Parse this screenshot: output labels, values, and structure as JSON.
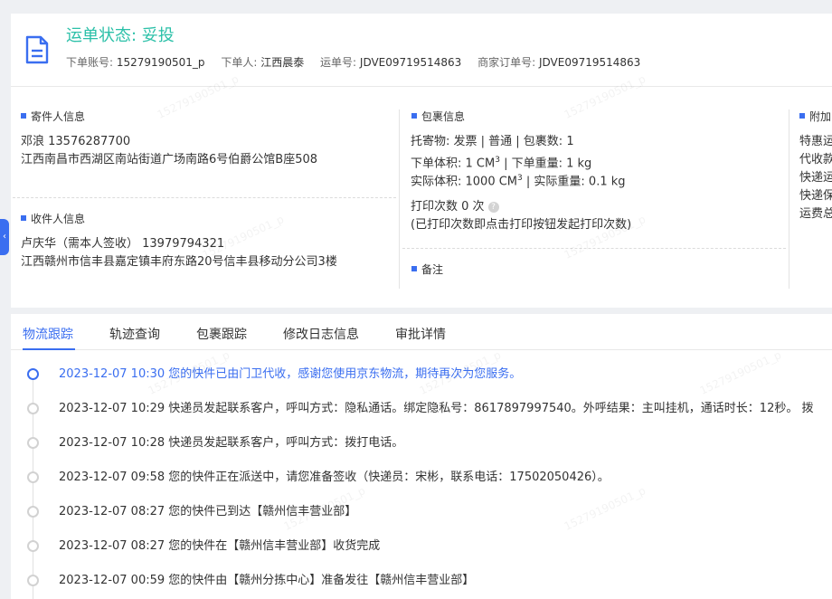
{
  "header": {
    "status_label": "运单状态: 妥投",
    "meta": [
      {
        "key": "下单账号:",
        "value": "15279190501_p"
      },
      {
        "key": "下单人:",
        "value": "江西晨泰"
      },
      {
        "key": "运单号:",
        "value": "JDVE09719514863"
      },
      {
        "key": "商家订单号:",
        "value": "JDVE09719514863"
      }
    ]
  },
  "sender": {
    "title": "寄件人信息",
    "name_phone": "邓浪    13576287700",
    "address": "江西南昌市西湖区南站街道广场南路6号伯爵公馆B座508"
  },
  "receiver": {
    "title": "收件人信息",
    "name_phone": "卢庆华（需本人签收）   13979794321",
    "address": "江西赣州市信丰县嘉定镇丰府东路20号信丰县移动分公司3楼"
  },
  "package": {
    "title": "包裹信息",
    "goods": "托寄物:  发票 | 普通  |  包裹数:  1",
    "order_volume_prefix": "下单体积:    1 CM",
    "order_volume_sup": "3",
    "order_weight": "  |  下单重量:    1 kg",
    "actual_volume_prefix": "实际体积:    1000 CM",
    "actual_volume_sup": "3",
    "actual_weight": "  |  实际重量:    0.1 kg",
    "print_count": "打印次数    0 次",
    "print_hint": "(已打印次数即点击打印按钮发起打印次数)"
  },
  "remark": {
    "title": "备注"
  },
  "extra": {
    "title": "附加",
    "lines": [
      "特惠运",
      "代收款",
      "快递运",
      "快递保",
      "运费总"
    ]
  },
  "side_tab": {
    "icon": "‹"
  },
  "tabs": [
    {
      "label": "物流跟踪"
    },
    {
      "label": "轨迹查询"
    },
    {
      "label": "包裹跟踪"
    },
    {
      "label": "修改日志信息"
    },
    {
      "label": "审批详情"
    }
  ],
  "timeline": [
    {
      "text": "2023-12-07 10:30 您的快件已由门卫代收，感谢您使用京东物流，期待再次为您服务。"
    },
    {
      "text": "2023-12-07 10:29 快递员发起联系客户，呼叫方式：隐私通话。绑定隐私号：8617897997540。外呼结果：主叫挂机，通话时长：12秒。 拨"
    },
    {
      "text": "2023-12-07 10:28 快递员发起联系客户，呼叫方式：拨打电话。"
    },
    {
      "text": "2023-12-07 09:58 您的快件正在派送中，请您准备签收（快递员：宋彬，联系电话：17502050426）。"
    },
    {
      "text": "2023-12-07 08:27 您的快件已到达【赣州信丰营业部】"
    },
    {
      "text": "2023-12-07 08:27 您的快件在【赣州信丰营业部】收货完成"
    },
    {
      "text": "2023-12-07 00:59 您的快件由【赣州分拣中心】准备发往【赣州信丰营业部】"
    }
  ],
  "watermark": "15279190501_p",
  "colors": {
    "accent": "#3a6ef0",
    "status": "#2bc0a8"
  }
}
